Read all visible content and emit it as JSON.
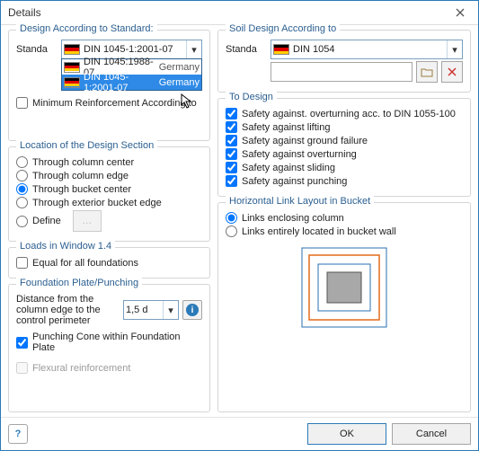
{
  "window": {
    "title": "Details"
  },
  "left": {
    "designStd": {
      "title": "Design According to Standard:",
      "standardLabel": "Standa",
      "selected": "DIN 1045-1:2001-07",
      "options": [
        {
          "label": "DIN 1045:1988-07",
          "country": "Germany"
        },
        {
          "label": "DIN 1045-1:2001-07",
          "country": "Germany"
        }
      ],
      "minReinf": "Minimum Reinforcement According to"
    },
    "location": {
      "title": "Location of the Design Section",
      "opts": [
        "Through column center",
        "Through column edge",
        "Through bucket center",
        "Through exterior bucket edge",
        "Define"
      ]
    },
    "loads": {
      "title": "Loads in Window 1.4",
      "equal": "Equal for all foundations"
    },
    "plate": {
      "title": "Foundation Plate/Punching",
      "distanceLabel": "Distance from the column edge to the control perimeter",
      "distanceValue": "1,5 d",
      "punching": "Punching Cone within Foundation Plate",
      "flexural": "Flexural reinforcement"
    }
  },
  "right": {
    "soil": {
      "title": "Soil Design According to",
      "standardLabel": "Standa",
      "selected": "DIN 1054"
    },
    "toDesign": {
      "title": "To Design",
      "items": [
        "Safety against. overturning acc. to DIN 1055-100",
        "Safety against lifting",
        "Safety against ground failure",
        "Safety against overturning",
        "Safety against sliding",
        "Safety against punching"
      ]
    },
    "links": {
      "title": "Horizontal Link Layout in Bucket",
      "opts": [
        "Links enclosing column",
        "Links entirely located in bucket wall"
      ]
    }
  },
  "footer": {
    "ok": "OK",
    "cancel": "Cancel"
  }
}
